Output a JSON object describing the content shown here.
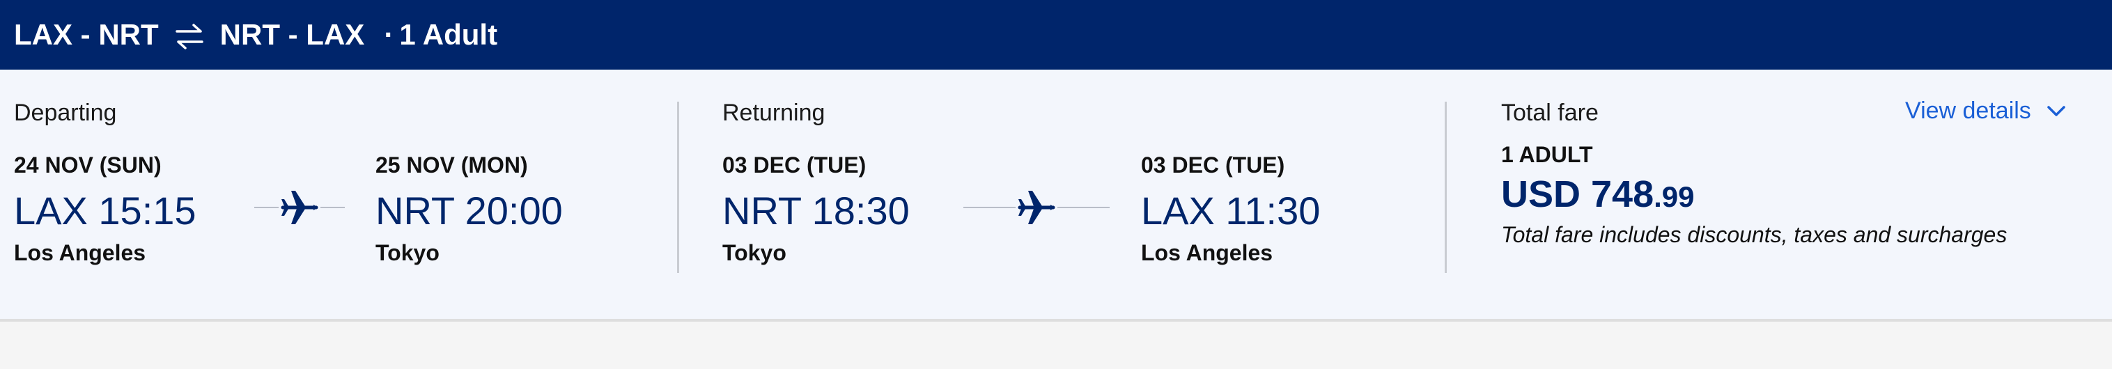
{
  "header": {
    "outbound_route": "LAX - NRT",
    "return_route": "NRT - LAX",
    "separator": "·",
    "passengers": "1 Adult",
    "swap_icon": "round-trip-arrows-icon"
  },
  "departing": {
    "label": "Departing",
    "origin": {
      "date": "24 NOV (SUN)",
      "time": "LAX 15:15",
      "city": "Los Angeles"
    },
    "destination": {
      "date": "25 NOV (MON)",
      "time": "NRT 20:00",
      "city": "Tokyo"
    },
    "icon": "airplane-icon"
  },
  "returning": {
    "label": "Returning",
    "origin": {
      "date": "03 DEC (TUE)",
      "time": "NRT 18:30",
      "city": "Tokyo"
    },
    "destination": {
      "date": "03 DEC (TUE)",
      "time": "LAX 11:30",
      "city": "Los Angeles"
    },
    "icon": "airplane-icon"
  },
  "fare": {
    "label": "Total fare",
    "view_details": "View details",
    "passenger_type": "1 ADULT",
    "currency_amount": "USD 748",
    "cents": ".99",
    "note": "Total fare includes discounts, taxes and surcharges"
  },
  "colors": {
    "header_bg": "#00256b",
    "accent_text": "#00256b",
    "link": "#1a5fd6",
    "panel_bg": "#f3f6fc",
    "page_bg": "#f5f5f5"
  }
}
